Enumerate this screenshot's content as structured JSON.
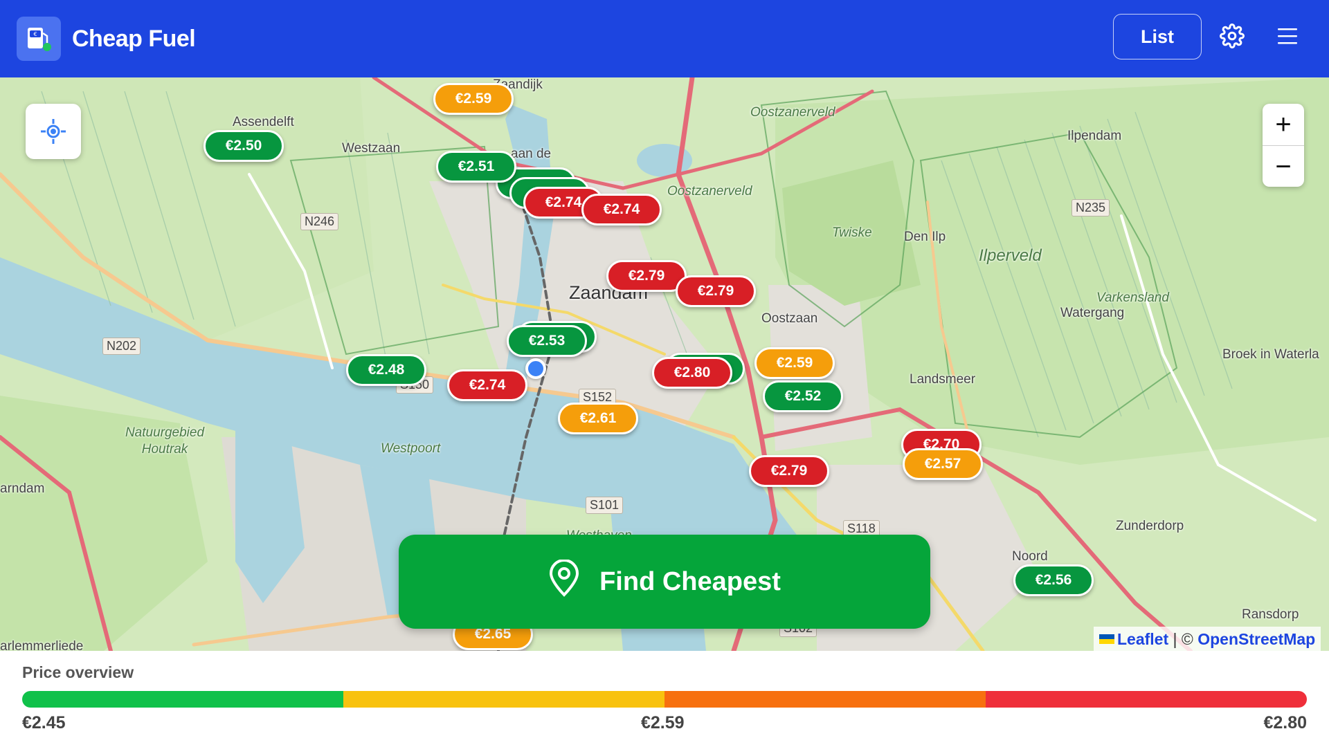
{
  "app": {
    "title": "Cheap Fuel",
    "logo_icon": "fuel-pump-icon",
    "list_button": "List",
    "settings_icon": "gear-icon",
    "menu_icon": "hamburger-menu-icon"
  },
  "map": {
    "places": [
      {
        "name": "Assendelft",
        "style": "normal"
      },
      {
        "name": "Westzaan",
        "style": "normal"
      },
      {
        "name": "Zaandijk",
        "style": "normal"
      },
      {
        "name": "Zaandam",
        "style": "big"
      },
      {
        "name": "Oostzanerveld",
        "style": "italic"
      },
      {
        "name": "Oostzanerveld",
        "style": "italic"
      },
      {
        "name": "Ilpendam",
        "style": "normal"
      },
      {
        "name": "Twiske",
        "style": "italic"
      },
      {
        "name": "Den Ilp",
        "style": "normal"
      },
      {
        "name": "Ilperveld",
        "style": "italic"
      },
      {
        "name": "Varkensland",
        "style": "italic"
      },
      {
        "name": "Watergang",
        "style": "normal"
      },
      {
        "name": "Oostzaan",
        "style": "normal"
      },
      {
        "name": "Broek in Waterla",
        "style": "normal"
      },
      {
        "name": "Landsmeer",
        "style": "normal"
      },
      {
        "name": "Natuurgebied Houtrak",
        "style": "italic"
      },
      {
        "name": "Westpoort",
        "style": "italic"
      },
      {
        "name": "arndam",
        "style": "normal"
      },
      {
        "name": "Zunderdorp",
        "style": "normal"
      },
      {
        "name": "Noord",
        "style": "normal"
      },
      {
        "name": "Ransdorp",
        "style": "normal"
      },
      {
        "name": "Westhaven",
        "style": "italic"
      },
      {
        "name": "aan de",
        "style": "normal"
      },
      {
        "name": "arlemmerliede",
        "style": "normal"
      }
    ],
    "road_signs": [
      "N246",
      "N202",
      "N235",
      "S150",
      "S152",
      "S101",
      "S118",
      "S102"
    ],
    "markers": [
      {
        "price": "€2.59",
        "color": "orange"
      },
      {
        "price": "€2.50",
        "color": "green"
      },
      {
        "price": "€2.51",
        "color": "green"
      },
      {
        "price": "€2.74",
        "color": "red"
      },
      {
        "price": "€2.74",
        "color": "red"
      },
      {
        "price": "€2.79",
        "color": "red"
      },
      {
        "price": "€2.79",
        "color": "red"
      },
      {
        "price": "€2.53",
        "color": "green"
      },
      {
        "price": "€2.48",
        "color": "green"
      },
      {
        "price": "€2.74",
        "color": "red"
      },
      {
        "price": "€2.61",
        "color": "orange"
      },
      {
        "price": "€2.80",
        "color": "red"
      },
      {
        "price": "€2.59",
        "color": "orange"
      },
      {
        "price": "€2.52",
        "color": "green"
      },
      {
        "price": "€2.70",
        "color": "red"
      },
      {
        "price": "€2.57",
        "color": "orange"
      },
      {
        "price": "€2.79",
        "color": "red"
      },
      {
        "price": "€2.56",
        "color": "green"
      },
      {
        "price": "€2.65",
        "color": "orange"
      }
    ],
    "locate_icon": "crosshair-locate-icon",
    "zoom_in": "+",
    "zoom_out": "−",
    "find_button": {
      "label": "Find Cheapest",
      "icon": "map-pin-icon"
    },
    "attribution": {
      "leaflet": "Leaflet",
      "separator": " | © ",
      "osm": "OpenStreetMap"
    }
  },
  "price_overview": {
    "title": "Price overview",
    "min_label": "€2.45",
    "mid_label": "€2.59",
    "max_label": "€2.80",
    "segment_colors": [
      "#10c14a",
      "#f8c20f",
      "#f7700f",
      "#ef2f3a"
    ]
  },
  "colors": {
    "header": "#1d45e0",
    "marker_green": "#07963f",
    "marker_red": "#d81f26",
    "marker_orange": "#f59e0b",
    "find_button": "#05a53a"
  }
}
